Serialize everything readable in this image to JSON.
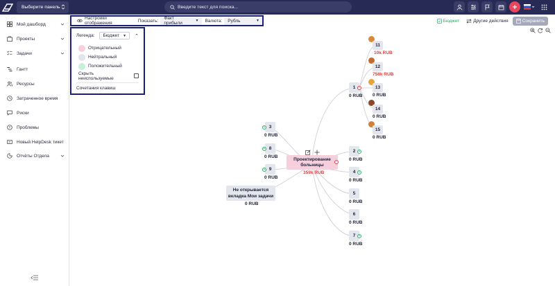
{
  "topbar": {
    "panel_select": "Выберите панель",
    "search_placeholder": "Введите текст для поиска..."
  },
  "sidebar": {
    "items": [
      {
        "label": "Мой дашборд"
      },
      {
        "label": "Проекты"
      },
      {
        "label": "Задачи"
      },
      {
        "label": "Гантт"
      },
      {
        "label": "Ресурсы"
      },
      {
        "label": "Затраченное время"
      },
      {
        "label": "Риски"
      },
      {
        "label": "Проблемы"
      },
      {
        "label": "Новый HelpDesk тикет"
      },
      {
        "label": "Отчёты Отдела"
      }
    ]
  },
  "toolbar": {
    "display_settings": "Настройки отображения",
    "show_label": "Показать:",
    "show_value": "Факт прибыли",
    "currency_label": "Валюта:",
    "currency_value": "Рубль"
  },
  "actions": {
    "budget": "Бюджет",
    "other": "Другие действия",
    "save": "Сохранить"
  },
  "legend": {
    "label": "Легенда:",
    "select_value": "Бюджет",
    "items": [
      {
        "label": "Отрицательный",
        "color": "#f6d2dc"
      },
      {
        "label": "Нейтральный",
        "color": "#e2e4ec"
      },
      {
        "label": "Положительный",
        "color": "#c8efd8"
      }
    ],
    "hide_unused": "Скрыть неиспользуемые",
    "shortcuts": "Сочетания клавиш"
  },
  "mindmap": {
    "root": {
      "title_line1": "Проектирование",
      "title_line2": "больницы",
      "value": "359k RUB"
    },
    "nodes": [
      {
        "id": "n11",
        "label": "11",
        "value": "10k RUB",
        "value_color": "red"
      },
      {
        "id": "n12",
        "label": "12",
        "value": "758k RUB",
        "value_color": "red"
      },
      {
        "id": "n13",
        "label": "13",
        "value": "0 RUB"
      },
      {
        "id": "n14",
        "label": "14",
        "value": "0 RUB"
      },
      {
        "id": "n15",
        "label": "15",
        "value": "0 RUB"
      },
      {
        "id": "n1",
        "label": "1",
        "value": "0 RUB"
      },
      {
        "id": "n2",
        "label": "2",
        "value": "0 RUB"
      },
      {
        "id": "n3",
        "label": "3",
        "value": "0 RUB"
      },
      {
        "id": "n4",
        "label": "4",
        "value": "0 RUB"
      },
      {
        "id": "n5",
        "label": "5",
        "value": "0 RUB"
      },
      {
        "id": "n6",
        "label": "6",
        "value": "0 RUB"
      },
      {
        "id": "n7",
        "label": "7",
        "value": "0 RUB"
      },
      {
        "id": "n8",
        "label": "8",
        "value": "0 RUB"
      },
      {
        "id": "n9",
        "label": "9",
        "value": "0 RUB"
      },
      {
        "id": "nm",
        "label_line1": "Не открывается",
        "label_line2": "вкладка Мои задачи",
        "value": "0 RUB"
      }
    ]
  },
  "colors": {
    "topbar": "#262a55",
    "accent_red": "#e8465d",
    "budget_green": "#2daf6d",
    "root_pink": "#f5d0dc",
    "value_red": "#e53e3e"
  },
  "icons": {
    "logo": "logo-icon",
    "search": "search-icon",
    "user": "user-icon",
    "flag": "flag-icon",
    "plus": "plus-icon",
    "grid": "grid-icon"
  }
}
